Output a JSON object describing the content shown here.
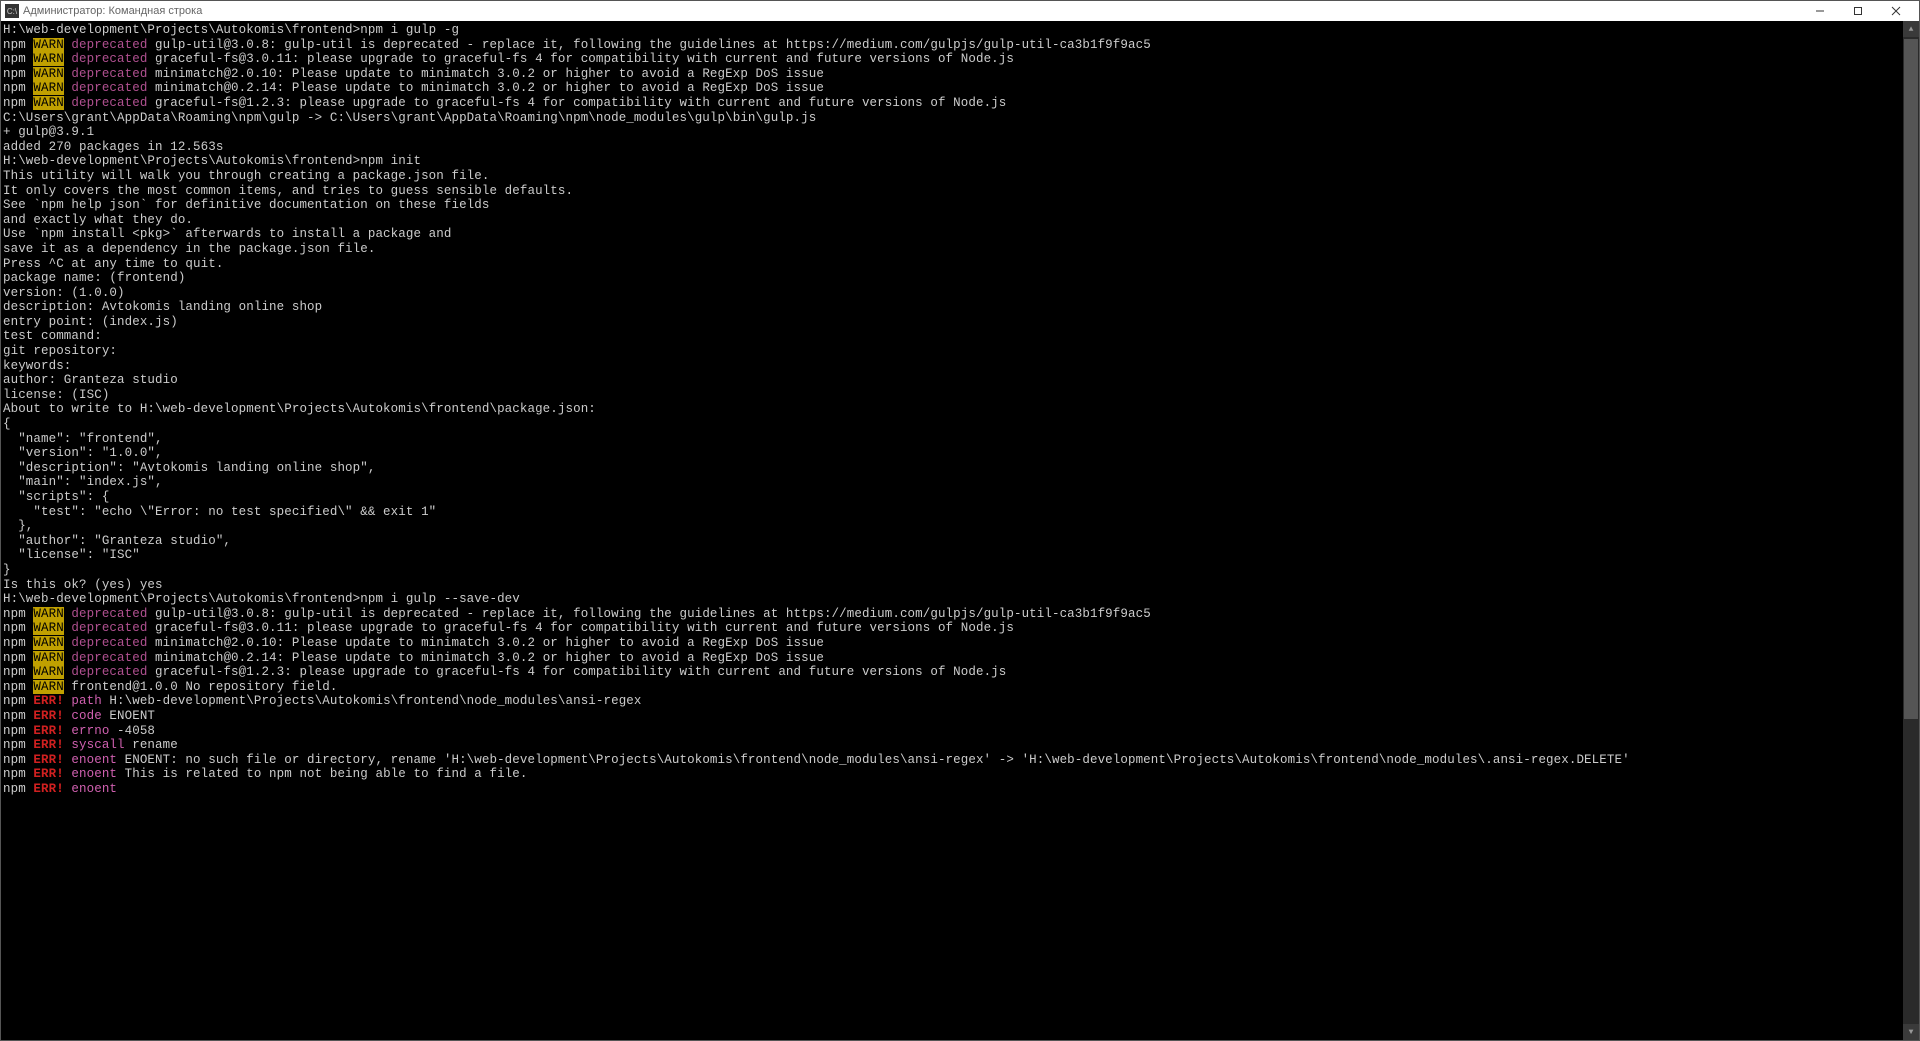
{
  "title": "Администратор: Командная строка",
  "prompt1": "H:\\web-development\\Projects\\Autokomis\\frontend>npm i gulp -g",
  "warn_lines_1": [
    {
      "prefix": "npm ",
      "warn": "WARN",
      "dep": " deprecated ",
      "msg": "gulp-util@3.0.8: gulp-util is deprecated - replace it, following the guidelines at https://medium.com/gulpjs/gulp-util-ca3b1f9f9ac5"
    },
    {
      "prefix": "npm ",
      "warn": "WARN",
      "dep": " deprecated ",
      "msg": "graceful-fs@3.0.11: please upgrade to graceful-fs 4 for compatibility with current and future versions of Node.js"
    },
    {
      "prefix": "npm ",
      "warn": "WARN",
      "dep": " deprecated ",
      "msg": "minimatch@2.0.10: Please update to minimatch 3.0.2 or higher to avoid a RegExp DoS issue"
    },
    {
      "prefix": "npm ",
      "warn": "WARN",
      "dep": " deprecated ",
      "msg": "minimatch@0.2.14: Please update to minimatch 3.0.2 or higher to avoid a RegExp DoS issue"
    },
    {
      "prefix": "npm ",
      "warn": "WARN",
      "dep": " deprecated ",
      "msg": "graceful-fs@1.2.3: please upgrade to graceful-fs 4 for compatibility with current and future versions of Node.js"
    }
  ],
  "post_install_1": "C:\\Users\\grant\\AppData\\Roaming\\npm\\gulp -> C:\\Users\\grant\\AppData\\Roaming\\npm\\node_modules\\gulp\\bin\\gulp.js",
  "post_install_2": "+ gulp@3.9.1",
  "post_install_3": "added 270 packages in 12.563s",
  "prompt2": "H:\\web-development\\Projects\\Autokomis\\frontend>npm init",
  "init_text": [
    "This utility will walk you through creating a package.json file.",
    "It only covers the most common items, and tries to guess sensible defaults.",
    "",
    "See `npm help json` for definitive documentation on these fields",
    "and exactly what they do.",
    "",
    "Use `npm install <pkg>` afterwards to install a package and",
    "save it as a dependency in the package.json file.",
    "",
    "Press ^C at any time to quit.",
    "package name: (frontend)",
    "version: (1.0.0)",
    "description: Avtokomis landing online shop",
    "entry point: (index.js)",
    "test command:",
    "git repository:",
    "keywords:",
    "author: Granteza studio",
    "license: (ISC)",
    "About to write to H:\\web-development\\Projects\\Autokomis\\frontend\\package.json:",
    "",
    "{",
    "  \"name\": \"frontend\",",
    "  \"version\": \"1.0.0\",",
    "  \"description\": \"Avtokomis landing online shop\",",
    "  \"main\": \"index.js\",",
    "  \"scripts\": {",
    "    \"test\": \"echo \\\"Error: no test specified\\\" && exit 1\"",
    "  },",
    "  \"author\": \"Granteza studio\",",
    "  \"license\": \"ISC\"",
    "}",
    "",
    "",
    "Is this ok? (yes) yes",
    ""
  ],
  "prompt3": "H:\\web-development\\Projects\\Autokomis\\frontend>npm i gulp --save-dev",
  "warn_lines_2": [
    {
      "prefix": "npm ",
      "warn": "WARN",
      "dep": " deprecated ",
      "msg": "gulp-util@3.0.8: gulp-util is deprecated - replace it, following the guidelines at https://medium.com/gulpjs/gulp-util-ca3b1f9f9ac5"
    },
    {
      "prefix": "npm ",
      "warn": "WARN",
      "dep": " deprecated ",
      "msg": "graceful-fs@3.0.11: please upgrade to graceful-fs 4 for compatibility with current and future versions of Node.js"
    },
    {
      "prefix": "npm ",
      "warn": "WARN",
      "dep": " deprecated ",
      "msg": "minimatch@2.0.10: Please update to minimatch 3.0.2 or higher to avoid a RegExp DoS issue"
    },
    {
      "prefix": "npm ",
      "warn": "WARN",
      "dep": " deprecated ",
      "msg": "minimatch@0.2.14: Please update to minimatch 3.0.2 or higher to avoid a RegExp DoS issue"
    },
    {
      "prefix": "npm ",
      "warn": "WARN",
      "dep": " deprecated ",
      "msg": "graceful-fs@1.2.3: please upgrade to graceful-fs 4 for compatibility with current and future versions of Node.js"
    },
    {
      "prefix": "npm ",
      "warn": "WARN",
      "dep": "",
      "msg": " frontend@1.0.0 No repository field."
    }
  ],
  "err_lines": [
    {
      "prefix": "npm ",
      "err": "ERR!",
      "type": " path ",
      "msg": "H:\\web-development\\Projects\\Autokomis\\frontend\\node_modules\\ansi-regex"
    },
    {
      "prefix": "npm ",
      "err": "ERR!",
      "type": " code ",
      "msg": "ENOENT"
    },
    {
      "prefix": "npm ",
      "err": "ERR!",
      "type": " errno ",
      "msg": "-4058"
    },
    {
      "prefix": "npm ",
      "err": "ERR!",
      "type": " syscall ",
      "msg": "rename"
    },
    {
      "prefix": "npm ",
      "err": "ERR!",
      "type": " enoent ",
      "msg": "ENOENT: no such file or directory, rename 'H:\\web-development\\Projects\\Autokomis\\frontend\\node_modules\\ansi-regex' -> 'H:\\web-development\\Projects\\Autokomis\\frontend\\node_modules\\.ansi-regex.DELETE'"
    },
    {
      "prefix": "npm ",
      "err": "ERR!",
      "type": " enoent ",
      "msg": "This is related to npm not being able to find a file."
    },
    {
      "prefix": "npm ",
      "err": "ERR!",
      "type": " enoent ",
      "msg": ""
    }
  ]
}
